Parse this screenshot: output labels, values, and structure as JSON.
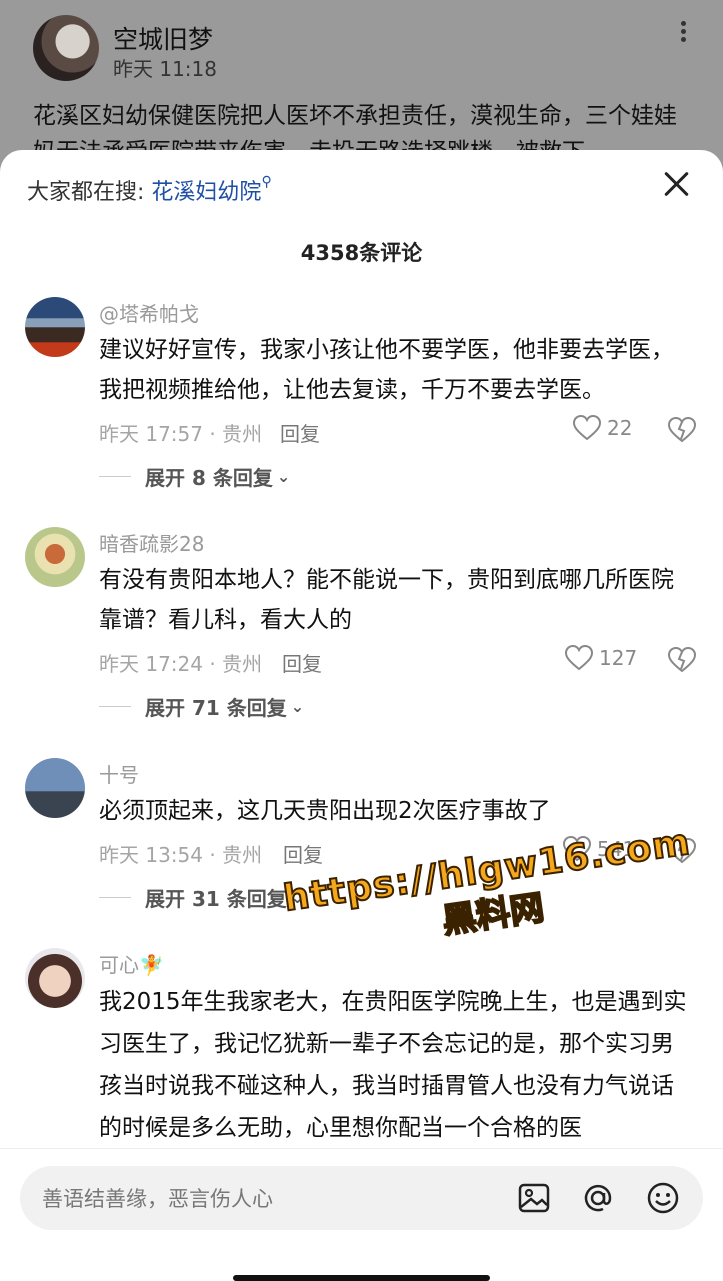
{
  "post": {
    "author": "空城旧梦",
    "time": "昨天 11:18",
    "text": "花溪区妇幼保健医院把人医坏不承担责任，漠视生命，三个娃娃妈无法承受医院带来伤害，走投无路选择跳楼，被救下"
  },
  "sheet": {
    "search_prefix": "大家都在搜:",
    "search_keyword": "花溪妇幼院",
    "comment_count": "4358条评论"
  },
  "comments": [
    {
      "name": "@塔希帕戈",
      "text": "建议好好宣传，我家小孩让他不要学医，他非要去学医，我把视频推给他，让他去复读，千万不要去学医。",
      "meta": "昨天 17:57 · 贵州",
      "reply": "回复",
      "likes": "22",
      "expand": "展开 8 条回复"
    },
    {
      "name": "暗香疏影28",
      "text": "有没有贵阳本地人？能不能说一下，贵阳到底哪几所医院靠谱？看儿科，看大人的",
      "meta": "昨天 17:24 · 贵州",
      "reply": "回复",
      "likes": "127",
      "expand": "展开 71 条回复"
    },
    {
      "name": "十号",
      "text": "必须顶起来，这几天贵阳出现2次医疗事故了",
      "meta": "昨天 13:54 · 贵州",
      "reply": "回复",
      "likes": "541",
      "expand": "展开 31 条回复"
    },
    {
      "name": "可心🧚",
      "text": "我2015年生我家老大，在贵阳医学院晚上生，也是遇到实习医生了，我记忆犹新一辈子不会忘记的是，那个实习男孩当时说我不碰这种人，我当时插胃管人也没有力气说话的时候是多么无助，心里想你配当一个合格的医"
    }
  ],
  "watermark": {
    "url": "https://hlgw16.com",
    "cn": "黑料网"
  },
  "composer": {
    "placeholder": "善语结善缘，恶言伤人心"
  },
  "icons": {
    "image": "image-icon",
    "mention": "at-icon",
    "emoji": "emoji-icon",
    "like": "heart-icon",
    "dislike": "broken-heart-icon",
    "more": "more-vertical-icon",
    "close": "close-icon"
  }
}
